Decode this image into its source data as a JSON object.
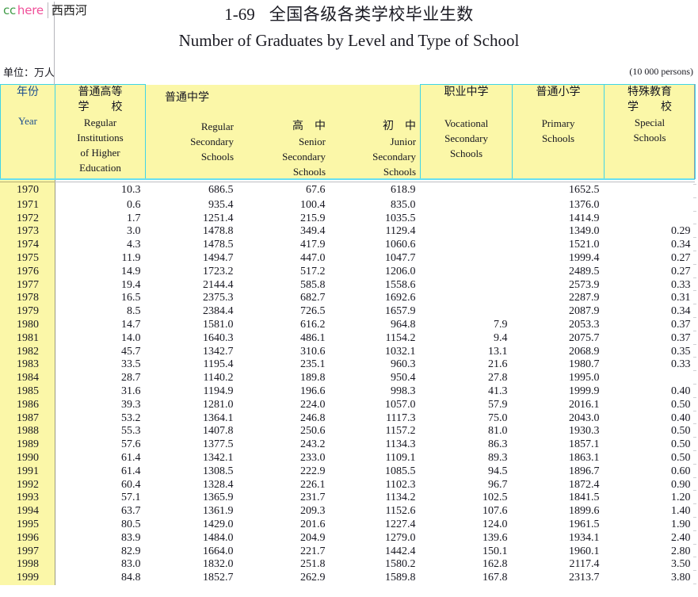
{
  "watermark": {
    "cc": "cc",
    "here": "here",
    "cn": "西西河"
  },
  "title": {
    "number": "1-69",
    "chinese": "全国各级各类学校毕业生数",
    "english": "Number of Graduates by Level and Type of School"
  },
  "unit": {
    "left": "单位：万人",
    "right": "(10 000 persons)"
  },
  "header": {
    "year": {
      "cn": "年份",
      "en": "Year"
    },
    "higher": {
      "cn_line1": "普通高等",
      "cn_line2": "学　　校",
      "en_line1": "Regular",
      "en_line2": "Institutions",
      "en_line3": "of Higher",
      "en_line4": "Education"
    },
    "secondary_group": {
      "cn": "普通中学"
    },
    "secondary_total": {
      "en_line1": "Regular",
      "en_line2": "Secondary",
      "en_line3": "Schools"
    },
    "senior": {
      "cn": "高　中",
      "en_line1": "Senior",
      "en_line2": "Secondary",
      "en_line3": "Schools"
    },
    "junior": {
      "cn": "初　中",
      "en_line1": "Junior",
      "en_line2": "Secondary",
      "en_line3": "Schools"
    },
    "vocational": {
      "cn": "职业中学",
      "en_line1": "Vocational",
      "en_line2": "Secondary",
      "en_line3": "Schools"
    },
    "primary": {
      "cn": "普通小学",
      "en_line1": "Primary",
      "en_line2": "Schools"
    },
    "special": {
      "cn_line1": "特殊教育",
      "cn_line2": "学　　校",
      "en_line1": "Special",
      "en_line2": "Schools"
    }
  },
  "chart_data": {
    "type": "table",
    "title": "1-69  全国各级各类学校毕业生数 / Number of Graduates by Level and Type of School",
    "unit": "10 000 persons",
    "columns": [
      "Year",
      "Regular Institutions of Higher Education",
      "Regular Secondary Schools",
      "Senior Secondary Schools",
      "Junior Secondary Schools",
      "Vocational Secondary Schools",
      "Primary Schools",
      "Special Schools"
    ],
    "rows": [
      [
        "1970",
        "10.3",
        "686.5",
        "67.6",
        "618.9",
        "",
        "1652.5",
        ""
      ],
      [
        "1971",
        "0.6",
        "935.4",
        "100.4",
        "835.0",
        "",
        "1376.0",
        ""
      ],
      [
        "1972",
        "1.7",
        "1251.4",
        "215.9",
        "1035.5",
        "",
        "1414.9",
        ""
      ],
      [
        "1973",
        "3.0",
        "1478.8",
        "349.4",
        "1129.4",
        "",
        "1349.0",
        "0.29"
      ],
      [
        "1974",
        "4.3",
        "1478.5",
        "417.9",
        "1060.6",
        "",
        "1521.0",
        "0.34"
      ],
      [
        "1975",
        "11.9",
        "1494.7",
        "447.0",
        "1047.7",
        "",
        "1999.4",
        "0.27"
      ],
      [
        "1976",
        "14.9",
        "1723.2",
        "517.2",
        "1206.0",
        "",
        "2489.5",
        "0.27"
      ],
      [
        "1977",
        "19.4",
        "2144.4",
        "585.8",
        "1558.6",
        "",
        "2573.9",
        "0.33"
      ],
      [
        "1978",
        "16.5",
        "2375.3",
        "682.7",
        "1692.6",
        "",
        "2287.9",
        "0.31"
      ],
      [
        "1979",
        "8.5",
        "2384.4",
        "726.5",
        "1657.9",
        "",
        "2087.9",
        "0.34"
      ],
      [
        "1980",
        "14.7",
        "1581.0",
        "616.2",
        "964.8",
        "7.9",
        "2053.3",
        "0.37"
      ],
      [
        "1981",
        "14.0",
        "1640.3",
        "486.1",
        "1154.2",
        "9.4",
        "2075.7",
        "0.37"
      ],
      [
        "1982",
        "45.7",
        "1342.7",
        "310.6",
        "1032.1",
        "13.1",
        "2068.9",
        "0.35"
      ],
      [
        "1983",
        "33.5",
        "1195.4",
        "235.1",
        "960.3",
        "21.6",
        "1980.7",
        "0.33"
      ],
      [
        "1984",
        "28.7",
        "1140.2",
        "189.8",
        "950.4",
        "27.8",
        "1995.0",
        ""
      ],
      [
        "1985",
        "31.6",
        "1194.9",
        "196.6",
        "998.3",
        "41.3",
        "1999.9",
        "0.40"
      ],
      [
        "1986",
        "39.3",
        "1281.0",
        "224.0",
        "1057.0",
        "57.9",
        "2016.1",
        "0.50"
      ],
      [
        "1987",
        "53.2",
        "1364.1",
        "246.8",
        "1117.3",
        "75.0",
        "2043.0",
        "0.40"
      ],
      [
        "1988",
        "55.3",
        "1407.8",
        "250.6",
        "1157.2",
        "81.0",
        "1930.3",
        "0.50"
      ],
      [
        "1989",
        "57.6",
        "1377.5",
        "243.2",
        "1134.3",
        "86.3",
        "1857.1",
        "0.50"
      ],
      [
        "1990",
        "61.4",
        "1342.1",
        "233.0",
        "1109.1",
        "89.3",
        "1863.1",
        "0.50"
      ],
      [
        "1991",
        "61.4",
        "1308.5",
        "222.9",
        "1085.5",
        "94.5",
        "1896.7",
        "0.60"
      ],
      [
        "1992",
        "60.4",
        "1328.4",
        "226.1",
        "1102.3",
        "96.7",
        "1872.4",
        "0.90"
      ],
      [
        "1993",
        "57.1",
        "1365.9",
        "231.7",
        "1134.2",
        "102.5",
        "1841.5",
        "1.20"
      ],
      [
        "1994",
        "63.7",
        "1361.9",
        "209.3",
        "1152.6",
        "107.6",
        "1899.6",
        "1.40"
      ],
      [
        "1995",
        "80.5",
        "1429.0",
        "201.6",
        "1227.4",
        "124.0",
        "1961.5",
        "1.90"
      ],
      [
        "1996",
        "83.9",
        "1484.0",
        "204.9",
        "1279.0",
        "139.6",
        "1934.1",
        "2.40"
      ],
      [
        "1997",
        "82.9",
        "1664.0",
        "221.7",
        "1442.4",
        "150.1",
        "1960.1",
        "2.80"
      ],
      [
        "1998",
        "83.0",
        "1832.0",
        "251.8",
        "1580.2",
        "162.8",
        "2117.4",
        "3.50"
      ],
      [
        "1999",
        "84.8",
        "1852.7",
        "262.9",
        "1589.8",
        "167.8",
        "2313.7",
        "3.80"
      ]
    ]
  },
  "colors": {
    "header_bg": "#fbf7a8",
    "header_border": "#3fd4e8",
    "year_text": "#1d4f8f",
    "watermark_cc": "#3f9b46",
    "watermark_here": "#f0509a"
  }
}
